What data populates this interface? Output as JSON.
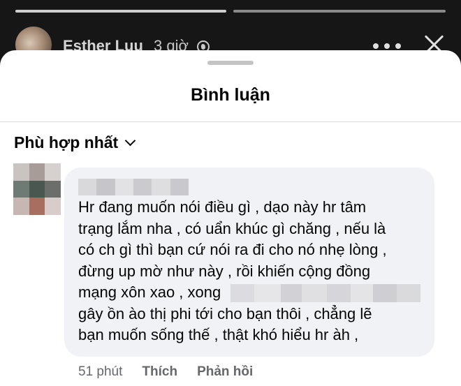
{
  "story": {
    "author": "Esther Luu",
    "time": "3 giờ",
    "privacy_icon": "globe-icon",
    "more_icon": "more-icon",
    "close_icon": "close-icon"
  },
  "sheet": {
    "title": "Bình luận",
    "sort_label": "Phù hợp nhất",
    "sort_icon": "chevron-down-icon"
  },
  "comment": {
    "author_redacted": true,
    "lines": [
      "Hr đang muốn nói điều gì , dạo này hr tâm",
      "trạng lắm nha , có uẩn khúc gì chăng , nếu là",
      "có ch gì thì bạn cứ nói ra đi cho nó nhẹ lòng ,",
      "đừng up mờ như này , rồi khiến cộng đồng",
      "mạng xôn xao , xong",
      "gây ồn ào thị phi tới cho bạn thôi , chẳng lẽ",
      "bạn muốn sống thế , thật khó hiểu hr àh ,"
    ],
    "time": "51 phút",
    "like_label": "Thích",
    "reply_label": "Phản hồi"
  },
  "colors": {
    "story_bg": "#161616",
    "sheet_bg": "#ffffff",
    "bubble_bg": "#f0f2f5",
    "text": "#050505",
    "meta_text": "#65676b"
  }
}
